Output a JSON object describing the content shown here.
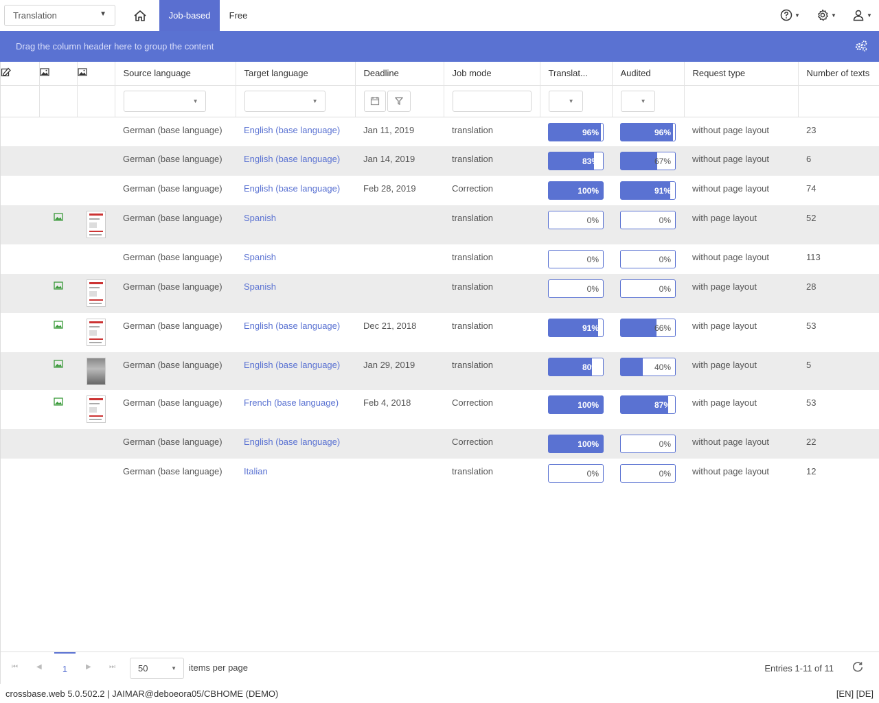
{
  "topbar": {
    "module": "Translation",
    "tabs": [
      {
        "label": "Job-based",
        "active": true
      },
      {
        "label": "Free",
        "active": false
      }
    ]
  },
  "group_panel": {
    "text": "Drag the column header here to group the content"
  },
  "columns": [
    "Source language",
    "Target language",
    "Deadline",
    "Job mode",
    "Translat...",
    "Audited",
    "Request type",
    "Number of texts"
  ],
  "rows": [
    {
      "source": "German (base language)",
      "target": "English (base language)",
      "deadline": "Jan 11, 2019",
      "mode": "translation",
      "translated": "96%",
      "translated_value": 0.96,
      "audited": "96%",
      "audited_value": 0.96,
      "request": "without page layout",
      "texts": "23",
      "alt": false,
      "thumb": "none"
    },
    {
      "source": "German (base language)",
      "target": "English (base language)",
      "deadline": "Jan 14, 2019",
      "mode": "translation",
      "translated": "83%",
      "translated_value": 0.83,
      "audited": "67%",
      "audited_value": 0.67,
      "request": "without page layout",
      "texts": "6",
      "alt": true,
      "thumb": "none"
    },
    {
      "source": "German (base language)",
      "target": "English (base language)",
      "deadline": "Feb 28, 2019",
      "mode": "Correction",
      "translated": "100%",
      "translated_value": 1.0,
      "audited": "91%",
      "audited_value": 0.91,
      "request": "without page layout",
      "texts": "74",
      "alt": false,
      "thumb": "none"
    },
    {
      "source": "German (base language)",
      "target": "Spanish",
      "deadline": "",
      "mode": "translation",
      "translated": "0%",
      "translated_value": 0,
      "audited": "0%",
      "audited_value": 0,
      "request": "with page layout",
      "texts": "52",
      "alt": true,
      "thumb": "doc"
    },
    {
      "source": "German (base language)",
      "target": "Spanish",
      "deadline": "",
      "mode": "translation",
      "translated": "0%",
      "translated_value": 0,
      "audited": "0%",
      "audited_value": 0,
      "request": "without page layout",
      "texts": "113",
      "alt": false,
      "thumb": "none"
    },
    {
      "source": "German (base language)",
      "target": "Spanish",
      "deadline": "",
      "mode": "translation",
      "translated": "0%",
      "translated_value": 0,
      "audited": "0%",
      "audited_value": 0,
      "request": "with page layout",
      "texts": "28",
      "alt": true,
      "thumb": "doc"
    },
    {
      "source": "German (base language)",
      "target": "English (base language)",
      "deadline": "Dec 21, 2018",
      "mode": "translation",
      "translated": "91%",
      "translated_value": 0.91,
      "audited": "66%",
      "audited_value": 0.66,
      "request": "with page layout",
      "texts": "53",
      "alt": false,
      "thumb": "doc"
    },
    {
      "source": "German (base language)",
      "target": "English (base language)",
      "deadline": "Jan 29, 2019",
      "mode": "translation",
      "translated": "80%",
      "translated_value": 0.8,
      "audited": "40%",
      "audited_value": 0.4,
      "request": "with page layout",
      "texts": "5",
      "alt": true,
      "thumb": "photo"
    },
    {
      "source": "German (base language)",
      "target": "French (base language)",
      "deadline": "Feb 4, 2018",
      "mode": "Correction",
      "translated": "100%",
      "translated_value": 1.0,
      "audited": "87%",
      "audited_value": 0.87,
      "request": "with page layout",
      "texts": "53",
      "alt": false,
      "thumb": "doc"
    },
    {
      "source": "German (base language)",
      "target": "English (base language)",
      "deadline": "",
      "mode": "Correction",
      "translated": "100%",
      "translated_value": 1.0,
      "audited": "0%",
      "audited_value": 0,
      "request": "without page layout",
      "texts": "22",
      "alt": true,
      "thumb": "none"
    },
    {
      "source": "German (base language)",
      "target": "Italian",
      "deadline": "",
      "mode": "translation",
      "translated": "0%",
      "translated_value": 0,
      "audited": "0%",
      "audited_value": 0,
      "request": "without page layout",
      "texts": "12",
      "alt": false,
      "thumb": "none"
    }
  ],
  "pager": {
    "current_page": "1",
    "page_size": "50",
    "page_size_label": "items per page",
    "info": "Entries 1-11 of 11"
  },
  "statusbar": {
    "left": "crossbase.web 5.0.502.2 | JAIMAR@deboeora05/CBHOME (DEMO)",
    "right": "[EN] [DE]"
  },
  "colors": {
    "accent": "#5a72d2",
    "alt_row": "#ececec",
    "link": "#5a72d2"
  }
}
